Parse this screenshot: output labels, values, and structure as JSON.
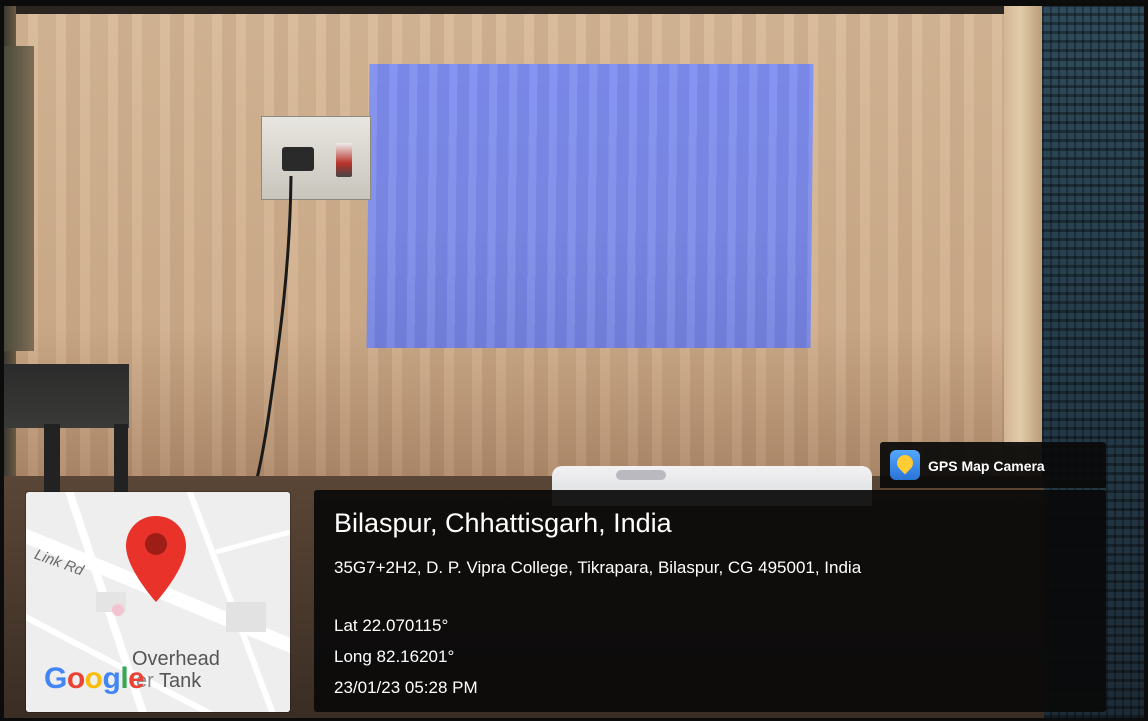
{
  "app_badge": {
    "name": "GPS Map Camera",
    "icon": "gps-map-camera-app-icon"
  },
  "location": {
    "title": "Bilaspur, Chhattisgarh, India",
    "address": "35G7+2H2, D. P. Vipra College, Tikrapara, Bilaspur, CG 495001, India",
    "lat": "Lat 22.070115°",
    "long": "Long 82.16201°",
    "datetime": "23/01/23 05:28 PM"
  },
  "map": {
    "road_label": "Link Rd",
    "poi_label_line1": "Overhead",
    "poi_label_line2": "Tank",
    "poi_label_partial": "er",
    "logo_text": "Google",
    "pin_color": "#e8322a"
  },
  "colors": {
    "overlay_bg": "#0a0a0a",
    "text": "#ffffff",
    "projection": "#7f8ef0"
  }
}
